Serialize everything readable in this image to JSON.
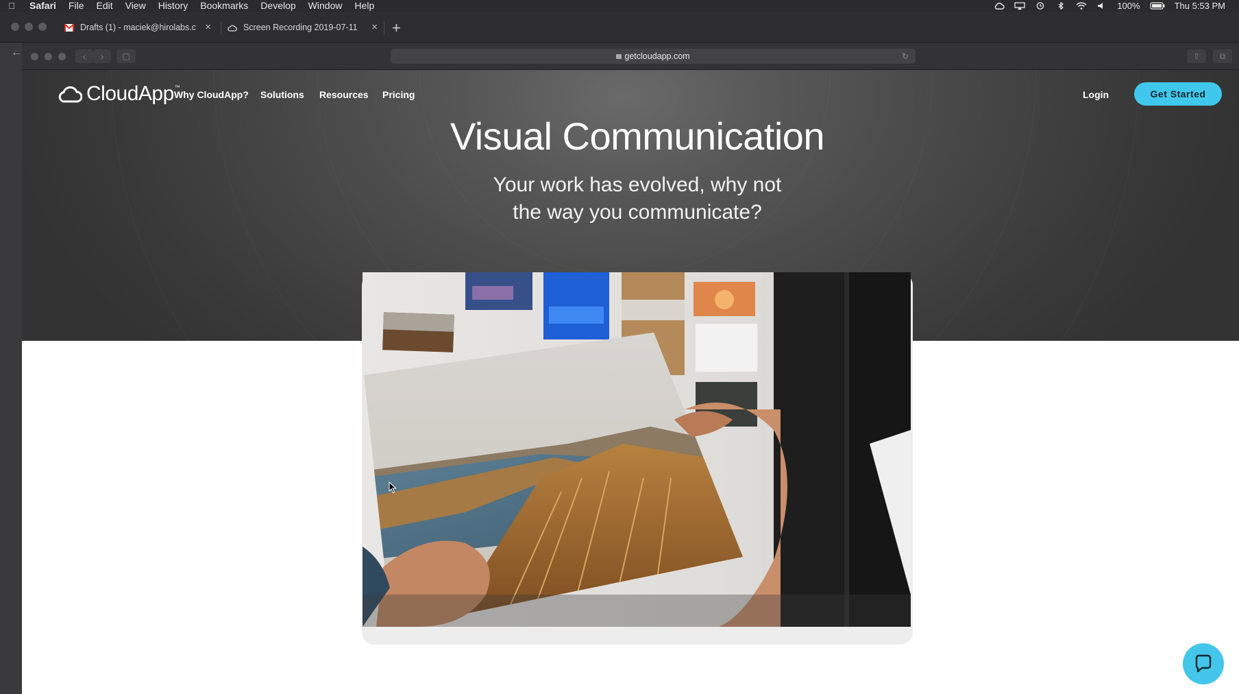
{
  "menubar": {
    "app": "Safari",
    "items": [
      "File",
      "Edit",
      "View",
      "History",
      "Bookmarks",
      "Develop",
      "Window",
      "Help"
    ],
    "battery": "100%",
    "clock": "Thu 5:53 PM"
  },
  "tabs": [
    {
      "title": "Drafts (1) - maciek@hirolabs.c",
      "icon": "gmail-icon"
    },
    {
      "title": "Screen Recording 2019-07-11",
      "icon": "cloudapp-icon"
    }
  ],
  "browser": {
    "url": "getcloudapp.com"
  },
  "site": {
    "logo_text": "CloudApp",
    "logo_tm": "™",
    "nav": [
      "Why CloudApp?",
      "Solutions",
      "Resources",
      "Pricing"
    ],
    "login": "Login",
    "cta": "Get Started",
    "headline": "Visual Communication",
    "subhead_line1": "Your work has evolved, why not",
    "subhead_line2": "the way you communicate?"
  },
  "colors": {
    "accent": "#40c8ec",
    "hero_bg": "#444444",
    "chat_button": "#44c6ea"
  }
}
